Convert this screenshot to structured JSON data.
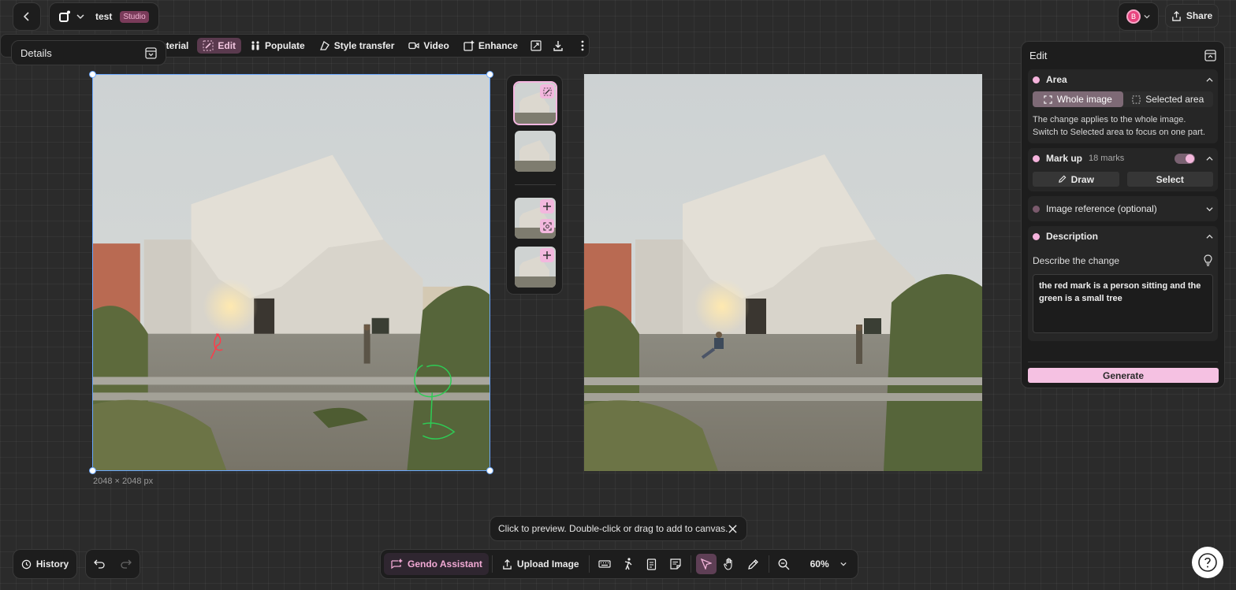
{
  "project": {
    "name": "test",
    "badge": "Studio"
  },
  "user": {
    "avatar_initial": "B"
  },
  "header": {
    "share_label": "Share"
  },
  "toolbar": {
    "items": [
      {
        "label": "aterial"
      },
      {
        "label": "Edit"
      },
      {
        "label": "Populate"
      },
      {
        "label": "Style transfer"
      },
      {
        "label": "Video"
      },
      {
        "label": "Enhance"
      }
    ]
  },
  "details": {
    "title": "Details"
  },
  "canvas": {
    "dimension_label": "2048 × 2048 px"
  },
  "edit_panel": {
    "title": "Edit",
    "area": {
      "title": "Area",
      "options": [
        "Whole image",
        "Selected area"
      ],
      "selected": "Whole image",
      "help": "The change applies to the whole image. Switch to Selected area to focus on one part."
    },
    "markup": {
      "title": "Mark up",
      "count": "18 marks",
      "enabled": true,
      "draw_label": "Draw",
      "select_label": "Select"
    },
    "image_reference": {
      "title": "Image reference (optional)"
    },
    "description": {
      "title": "Description",
      "prompt_label": "Describe the change",
      "value": "the red mark is a person sitting and the green is a small tree"
    },
    "generate_label": "Generate"
  },
  "toast": {
    "text": "Click to preview. Double-click or drag to add to canvas."
  },
  "bottom": {
    "history_label": "History",
    "assistant_label": "Gendo Assistant",
    "upload_label": "Upload Image",
    "zoom": "60%"
  },
  "colors": {
    "accent": "#f5b6e0",
    "selection": "#6aa8ff",
    "canvas": "#2b2b2b"
  }
}
